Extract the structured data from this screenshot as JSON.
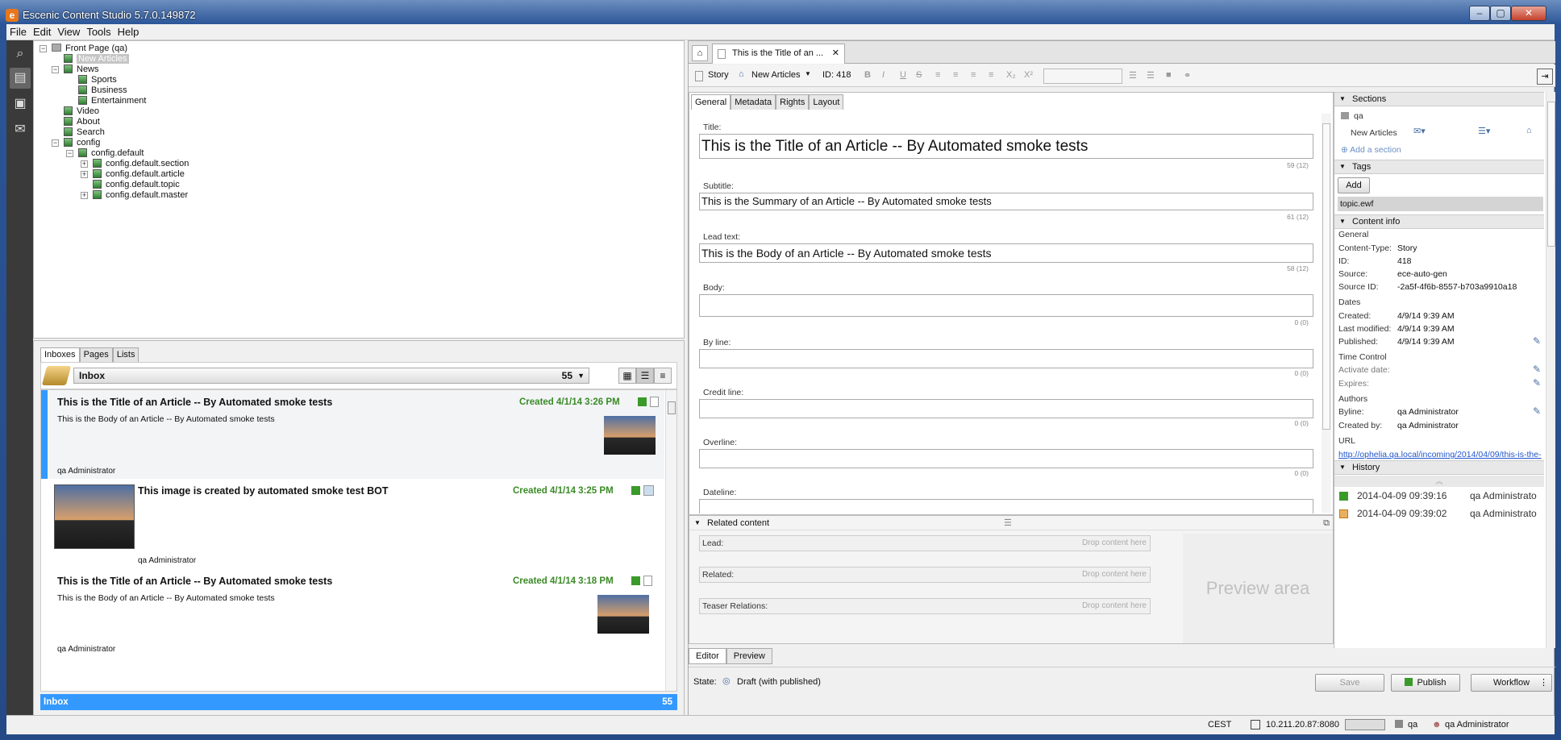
{
  "window": {
    "title": "Escenic Content Studio 5.7.0.149872"
  },
  "menu": [
    "File",
    "Edit",
    "View",
    "Tools",
    "Help"
  ],
  "tree": {
    "root": "Front Page (qa)",
    "nodes": [
      "New Articles",
      "News",
      "Sports",
      "Business",
      "Entertainment",
      "Video",
      "About",
      "Search",
      "config",
      "config.default",
      "config.default.section",
      "config.default.article",
      "config.default.topic",
      "config.default.master"
    ]
  },
  "inbox_panel": {
    "tabs": [
      "Inboxes",
      "Pages",
      "Lists"
    ],
    "selected": "Inbox",
    "count": "55",
    "items": [
      {
        "title": "This is the Title of an Article -- By Automated smoke tests",
        "body": "This is the Body of an Article -- By Automated smoke tests",
        "created": "Created 4/1/14 3:26 PM",
        "author": "qa Administrator"
      },
      {
        "title": "This image is created by automated smoke test BOT",
        "body": "",
        "created": "Created 4/1/14 3:25 PM",
        "author": "qa Administrator"
      },
      {
        "title": "This is the Title of an Article -- By Automated smoke tests",
        "body": "This is the Body of an Article -- By Automated smoke tests",
        "created": "Created 4/1/14 3:18 PM",
        "author": "qa Administrator"
      }
    ],
    "footer": {
      "label": "Inbox",
      "count": "55"
    }
  },
  "editor": {
    "doc_tab": "This is the Title of an ...",
    "type": "Story",
    "section": "New Articles",
    "id_label": "ID: 418",
    "form_tabs": [
      "General",
      "Metadata",
      "Rights",
      "Layout"
    ],
    "fields": [
      {
        "label": "Title:",
        "value": "This is the Title of an Article -- By Automated smoke tests",
        "count": "59 (12)"
      },
      {
        "label": "Subtitle:",
        "value": "This is the Summary of an Article -- By Automated smoke tests",
        "count": "61 (12)"
      },
      {
        "label": "Lead text:",
        "value": "This is the Body of an Article -- By Automated smoke tests",
        "count": "58 (12)"
      },
      {
        "label": "Body:",
        "value": "",
        "count": "0 (0)"
      },
      {
        "label": "By line:",
        "value": "",
        "count": "0 (0)"
      },
      {
        "label": "Credit line:",
        "value": "",
        "count": "0 (0)"
      },
      {
        "label": "Overline:",
        "value": "",
        "count": "0 (0)"
      },
      {
        "label": "Dateline:",
        "value": "",
        "count": ""
      }
    ],
    "related": {
      "header": "Related content",
      "slots": [
        {
          "label": "Lead:",
          "hint": "Drop content here"
        },
        {
          "label": "Related:",
          "hint": "Drop content here"
        },
        {
          "label": "Teaser Relations:",
          "hint": "Drop content here"
        }
      ],
      "preview": "Preview area"
    },
    "bottom_tabs": [
      "Editor",
      "Preview"
    ],
    "state_label": "State:",
    "state_value": "Draft (with published)",
    "buttons": {
      "save": "Save",
      "publish": "Publish",
      "workflow": "Workflow"
    }
  },
  "side": {
    "sections_header": "Sections",
    "sections_root": "qa",
    "section_item": "New Articles",
    "add_section": "Add a section",
    "tags_header": "Tags",
    "add_tag": "Add",
    "tag": "topic.ewf",
    "content_info_header": "Content info",
    "general": "General",
    "info": [
      {
        "k": "Content-Type:",
        "v": "Story"
      },
      {
        "k": "ID:",
        "v": "418"
      },
      {
        "k": "Source:",
        "v": "ece-auto-gen"
      },
      {
        "k": "Source ID:",
        "v": "-2a5f-4f6b-8557-b703a9910a18"
      }
    ],
    "dates_label": "Dates",
    "dates": [
      {
        "k": "Created:",
        "v": "4/9/14 9:39 AM"
      },
      {
        "k": "Last modified:",
        "v": "4/9/14 9:39 AM"
      },
      {
        "k": "Published:",
        "v": "4/9/14 9:39 AM"
      }
    ],
    "time_control": "Time Control",
    "activate": "Activate date:",
    "expires": "Expires:",
    "authors": "Authors",
    "byline_k": "Byline:",
    "byline_v": "qa Administrator",
    "createdby_k": "Created by:",
    "createdby_v": "qa Administrator",
    "url_label": "URL",
    "url": "http://ophelia.qa.local/incoming/2014/04/09/this-is-the-",
    "history_header": "History",
    "history": [
      {
        "time": "2014-04-09 09:39:16",
        "user": "qa Administrato"
      },
      {
        "time": "2014-04-09 09:39:02",
        "user": "qa Administrato"
      }
    ]
  },
  "statusbar": {
    "tz": "CEST",
    "server": "10.211.20.87:8080",
    "pub": "qa",
    "user": "qa Administrator"
  }
}
